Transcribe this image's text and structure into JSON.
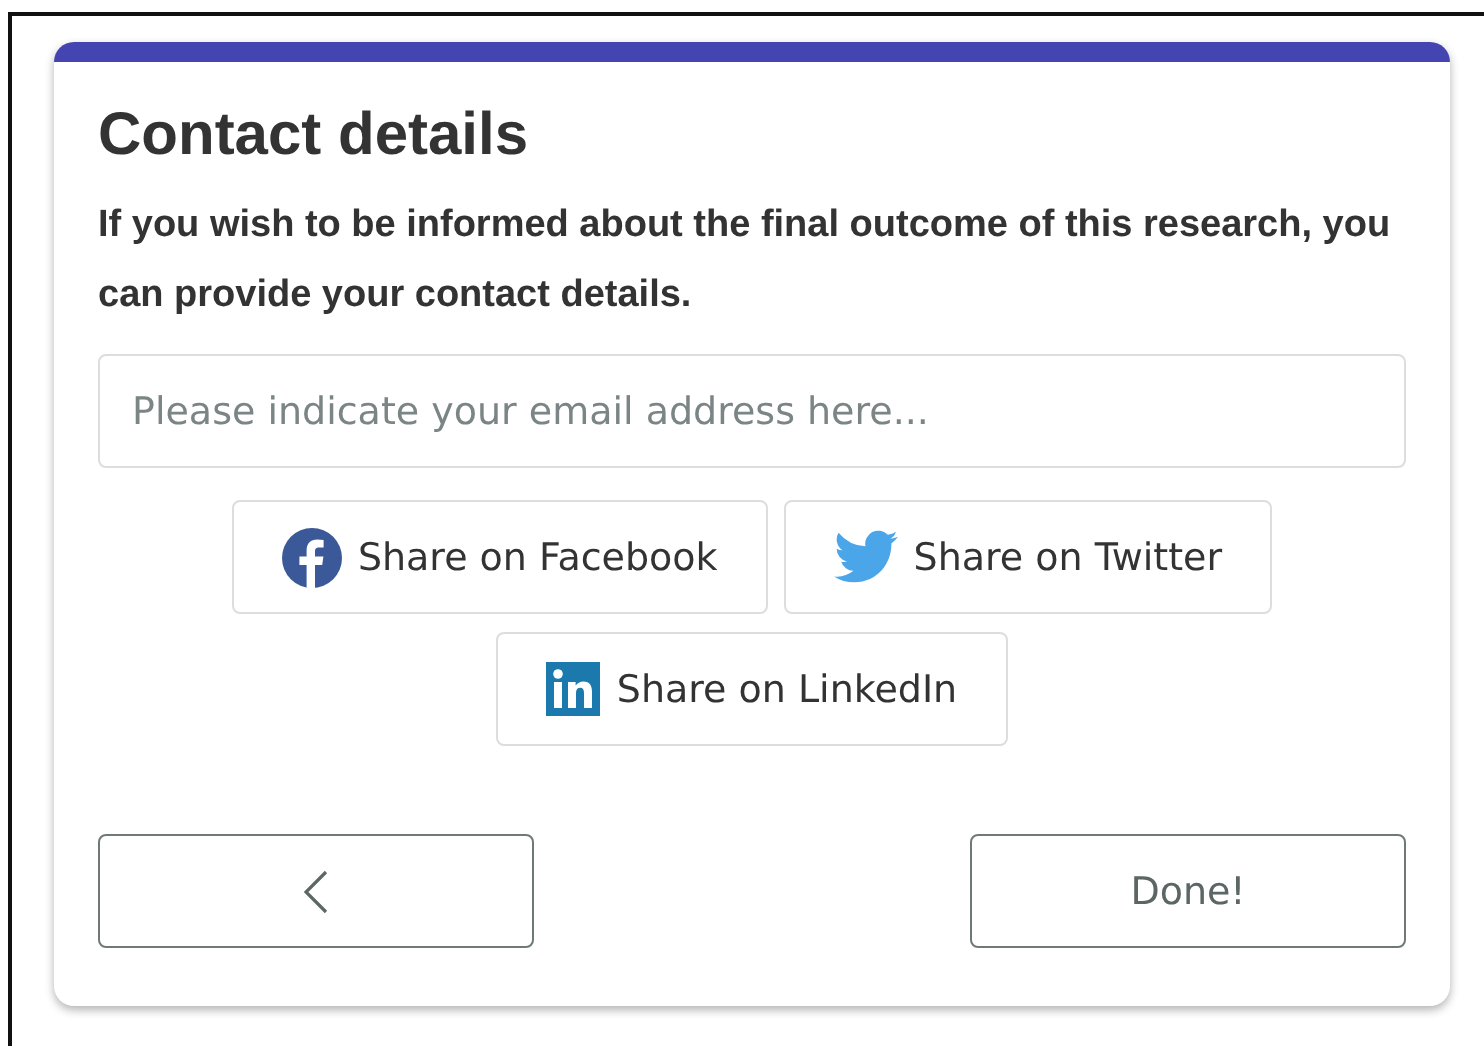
{
  "card": {
    "title": "Contact details",
    "description": "If you wish to be informed about the final outcome of this research, you can provide your contact details.",
    "email_field": {
      "placeholder": "Please indicate your email address here..."
    },
    "share_buttons": [
      {
        "kind": "facebook",
        "label": "Share on Facebook"
      },
      {
        "kind": "twitter",
        "label": "Share on Twitter"
      },
      {
        "kind": "linkedin",
        "label": "Share on LinkedIn"
      }
    ],
    "done_button": "Done!"
  }
}
